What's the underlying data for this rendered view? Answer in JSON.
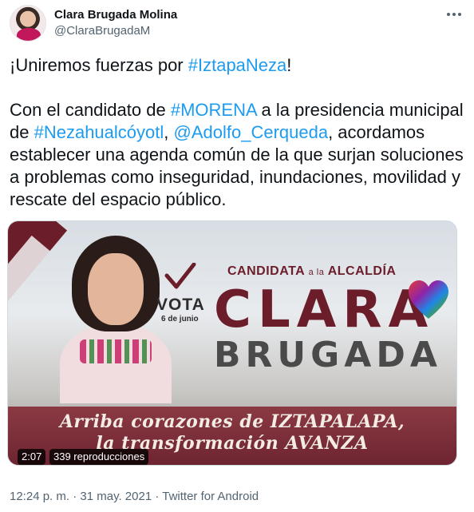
{
  "author": {
    "name": "Clara Brugada Molina",
    "handle": "@ClaraBrugadaM"
  },
  "tweet": {
    "line1_prefix": "¡Uniremos fuerzas por ",
    "line1_tag": "#IztapaNeza",
    "line1_suffix": "!",
    "p2_a": "Con el candidato de ",
    "p2_tag1": "#MORENA",
    "p2_b": " a la presidencia municipal de ",
    "p2_tag2": "#Nezahualcóyotl",
    "p2_c": ", ",
    "p2_tag3": "@Adolfo_Cerqueda",
    "p2_d": ", acordamos establecer una agenda común de la que surjan soluciones a problemas como inseguridad, inundaciones, movilidad y rescate del espacio público."
  },
  "media": {
    "vota": "VOTA",
    "fecha": "6 de junio",
    "candidata": "CANDIDATA",
    "a_la": "a la",
    "alcaldia": "ALCALDÍA",
    "clara": "CLARA",
    "brugada": "BRUGADA",
    "banner_line1": "Arriba corazones de IZTAPALAPA,",
    "banner_line2": "la transformación AVANZA",
    "duration": "2:07",
    "views": "339 reproducciones"
  },
  "meta": {
    "time": "12:24 p. m.",
    "sep": " · ",
    "date": "31 may. 2021",
    "source": "Twitter for Android"
  },
  "colors": {
    "link": "#1d9bf0",
    "brand_maroon": "#6b1d2a"
  },
  "icons": [
    "more-icon",
    "checkmark-icon",
    "heart-icon",
    "avatar"
  ]
}
